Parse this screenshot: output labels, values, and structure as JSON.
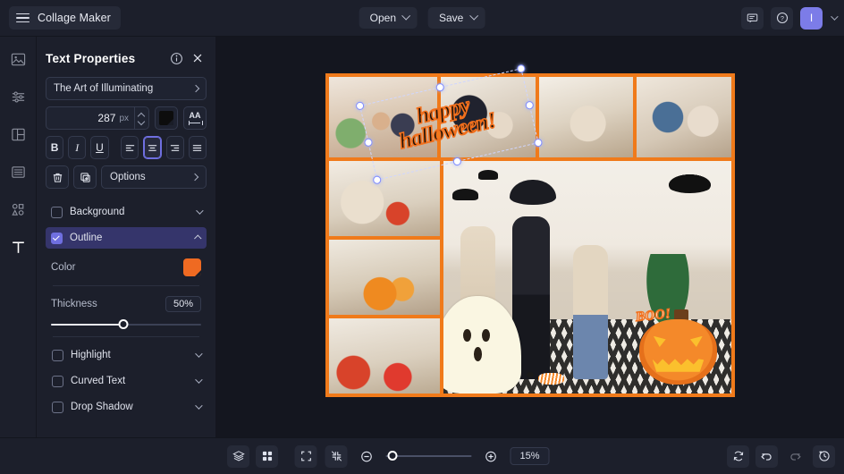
{
  "app": {
    "title": "Collage Maker",
    "menu_icon": "hamburger-icon"
  },
  "topbar": {
    "open_label": "Open",
    "save_label": "Save",
    "feedback_icon": "comment-icon",
    "help_icon": "question-circle-icon",
    "avatar_initial": "I",
    "avatar_color": "#7c7ce8"
  },
  "rail": {
    "items": [
      {
        "name": "sidebar-item-images",
        "icon": "image-icon",
        "active": false
      },
      {
        "name": "sidebar-item-adjust",
        "icon": "sliders-icon",
        "active": false
      },
      {
        "name": "sidebar-item-layouts",
        "icon": "layout-grid-icon",
        "active": false
      },
      {
        "name": "sidebar-item-backgrounds",
        "icon": "layers-list-icon",
        "active": false
      },
      {
        "name": "sidebar-item-graphics",
        "icon": "shapes-icon",
        "active": false
      },
      {
        "name": "sidebar-item-text",
        "icon": "text-t-icon",
        "active": true
      }
    ]
  },
  "panel": {
    "title": "Text Properties",
    "info_icon": "info-circle-icon",
    "close_icon": "close-icon",
    "font": {
      "value": "The Art of Illuminating",
      "chevron_icon": "chevron-right-icon"
    },
    "size": {
      "value": "287",
      "unit": "px",
      "stepper_icon": "stepper-arrows-icon"
    },
    "text_color": "#0d0d0d",
    "letter_spacing_label": "AA",
    "format_buttons": [
      {
        "name": "bold-button",
        "label": "B",
        "selected": false
      },
      {
        "name": "italic-button",
        "label": "I",
        "selected": false
      },
      {
        "name": "underline-button",
        "label": "U",
        "selected": false
      }
    ],
    "align_buttons": [
      {
        "name": "align-left-button",
        "icon": "align-left-icon",
        "selected": false
      },
      {
        "name": "align-center-button",
        "icon": "align-center-icon",
        "selected": true
      },
      {
        "name": "align-right-button",
        "icon": "align-right-icon",
        "selected": false
      },
      {
        "name": "align-justify-button",
        "icon": "align-justify-icon",
        "selected": false
      }
    ],
    "delete_icon": "trash-icon",
    "duplicate_icon": "duplicate-icon",
    "options_label": "Options",
    "sections": [
      {
        "name": "background-section",
        "label": "Background",
        "checked": false,
        "expanded": false
      },
      {
        "name": "outline-section",
        "label": "Outline",
        "checked": true,
        "expanded": true
      },
      {
        "name": "highlight-section",
        "label": "Highlight",
        "checked": false,
        "expanded": false
      },
      {
        "name": "curved-text-section",
        "label": "Curved Text",
        "checked": false,
        "expanded": false
      },
      {
        "name": "drop-shadow-section",
        "label": "Drop Shadow",
        "checked": false,
        "expanded": false
      }
    ],
    "outline": {
      "color_label": "Color",
      "color_value": "#ef6a22",
      "thickness_label": "Thickness",
      "thickness_value": "50%"
    },
    "accent_color": "#6f6fe0"
  },
  "canvas": {
    "border_color": "#f07a1a",
    "text_element": {
      "content_line1": "happy",
      "content_line2": "halloween!",
      "outline_color": "#f2701d",
      "fill_color": "#1d1208",
      "selected": true
    },
    "stickers": {
      "boo_text": "BOO!",
      "ghost": "ghost-sticker",
      "pumpkin": "jack-o-lantern-sticker",
      "bats": "bat-sticker",
      "candy": "candy-sticker",
      "spider": "spider-sticker"
    },
    "photos": [
      {
        "name": "photo-cell-1"
      },
      {
        "name": "photo-cell-2"
      },
      {
        "name": "photo-cell-3"
      },
      {
        "name": "photo-cell-4"
      },
      {
        "name": "photo-cell-5"
      },
      {
        "name": "photo-cell-6"
      },
      {
        "name": "photo-cell-7"
      },
      {
        "name": "photo-cell-8"
      }
    ]
  },
  "bottombar": {
    "layers_icon": "layers-icon",
    "grid_icon": "grid-icon",
    "fit_icon": "expand-frame-icon",
    "shrink_icon": "collapse-frame-icon",
    "zoom_out_icon": "minus-circle-icon",
    "zoom_in_icon": "plus-circle-icon",
    "zoom_value": "15%",
    "reset_icon": "refresh-icon",
    "undo_icon": "undo-icon",
    "redo_icon": "redo-icon",
    "history_icon": "history-icon"
  }
}
